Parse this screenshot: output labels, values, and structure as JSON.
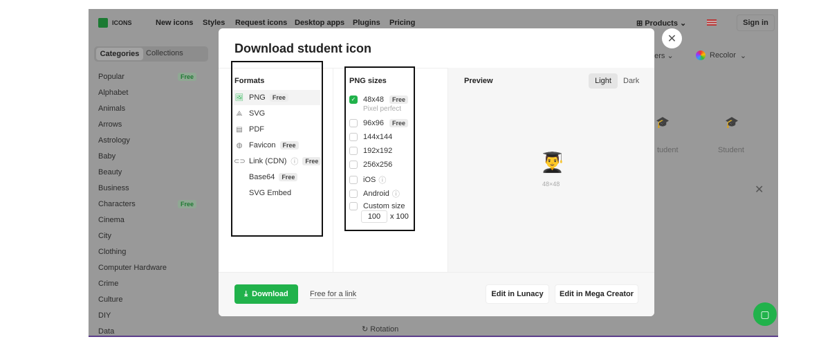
{
  "nav": {
    "logo": "ICONS",
    "items": [
      "New icons",
      "Styles",
      "Request icons",
      "Desktop apps",
      "Plugins",
      "Pricing"
    ],
    "products": "Products",
    "sign_in": "Sign in"
  },
  "sidebar": {
    "tabs": [
      "Categories",
      "Collections"
    ],
    "items": [
      {
        "label": "Popular",
        "badge": "Free"
      },
      {
        "label": "Alphabet"
      },
      {
        "label": "Animals"
      },
      {
        "label": "Arrows"
      },
      {
        "label": "Astrology"
      },
      {
        "label": "Baby"
      },
      {
        "label": "Beauty"
      },
      {
        "label": "Business"
      },
      {
        "label": "Characters",
        "badge": "Free"
      },
      {
        "label": "Cinema"
      },
      {
        "label": "City"
      },
      {
        "label": "Clothing"
      },
      {
        "label": "Computer Hardware"
      },
      {
        "label": "Crime"
      },
      {
        "label": "Culture"
      },
      {
        "label": "DIY"
      },
      {
        "label": "Data"
      }
    ]
  },
  "background": {
    "filter_partial": "ners",
    "recolor": "Recolor",
    "icon_label_partial": "tudent",
    "icon_label": "Student",
    "rotation": "Rotation"
  },
  "modal": {
    "title": "Download student icon",
    "formats": {
      "heading": "Formats",
      "items": [
        {
          "label": "PNG",
          "badge": "Free",
          "icon": "image-icon",
          "selected": true
        },
        {
          "label": "SVG",
          "icon": "vector-icon"
        },
        {
          "label": "PDF",
          "icon": "pdf-icon"
        },
        {
          "label": "Favicon",
          "badge": "Free",
          "icon": "globe-icon"
        },
        {
          "label": "Link (CDN)",
          "badge": "Free",
          "icon": "link-icon",
          "info": true
        },
        {
          "label": "Base64",
          "badge": "Free",
          "icon": "code-icon"
        },
        {
          "label": "SVG Embed",
          "icon": "code-icon"
        }
      ]
    },
    "sizes": {
      "heading": "PNG sizes",
      "items": [
        {
          "label": "48x48",
          "badge": "Free",
          "sub": "Pixel perfect",
          "checked": true
        },
        {
          "label": "96x96",
          "badge": "Free"
        },
        {
          "label": "144x144"
        },
        {
          "label": "192x192"
        },
        {
          "label": "256x256"
        },
        {
          "label": "iOS",
          "info": true
        },
        {
          "label": "Android",
          "info": true
        },
        {
          "label": "Custom size"
        }
      ],
      "custom_value": "100",
      "custom_suffix": "x 100"
    },
    "preview": {
      "heading": "Preview",
      "light": "Light",
      "dark": "Dark",
      "emoji": "👨‍🎓",
      "size": "48×48"
    },
    "footer": {
      "download": "Download",
      "free_link": "Free for a link",
      "lunacy": "Edit in Lunacy",
      "mega": "Edit in Mega Creator"
    }
  },
  "colors": {
    "accent": "#21b24b",
    "overlay": "#999999"
  }
}
